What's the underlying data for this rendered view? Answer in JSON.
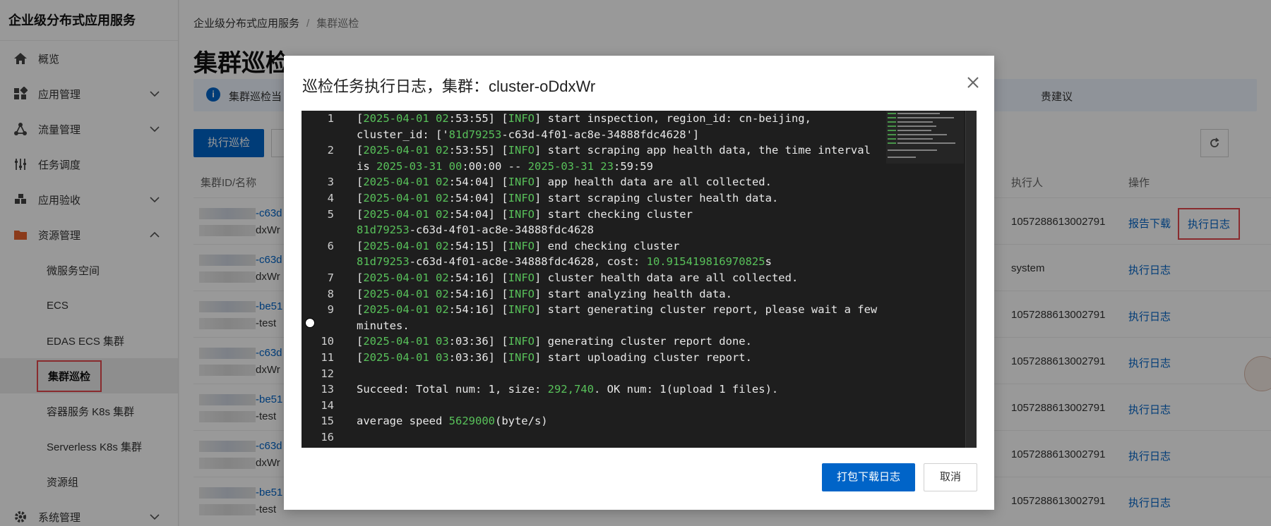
{
  "sidebar": {
    "product_title": "企业级分布式应用服务",
    "items": [
      {
        "label": "概览",
        "icon": "home-icon"
      },
      {
        "label": "应用管理",
        "icon": "apps-icon"
      },
      {
        "label": "流量管理",
        "icon": "traffic-icon"
      },
      {
        "label": "任务调度",
        "icon": "schedule-icon"
      },
      {
        "label": "应用验收",
        "icon": "acceptance-icon"
      },
      {
        "label": "资源管理",
        "icon": "folder-icon"
      }
    ],
    "sub_items": [
      "微服务空间",
      "ECS",
      "EDAS ECS 集群",
      "集群巡检",
      "容器服务 K8s 集群",
      "Serverless K8s 集群",
      "资源组"
    ],
    "bottom_item": {
      "label": "系统管理",
      "icon": "settings-icon"
    }
  },
  "breadcrumb": {
    "root": "企业级分布式应用服务",
    "separator": "/",
    "current": "集群巡检"
  },
  "page": {
    "title": "集群巡检",
    "info_text": "集群巡检当",
    "info_tail": "贵建议",
    "execute_button": "执行巡检"
  },
  "table": {
    "headers": {
      "id": "集群ID/名称",
      "executor": "执行人",
      "actions": "操作"
    },
    "rows": [
      {
        "id": "-c63d",
        "name": "dxWr",
        "executor": "1057288613002791",
        "actions": [
          "报告下载",
          "执行日志"
        ]
      },
      {
        "id": "-c63d",
        "name": "dxWr",
        "executor": "system",
        "actions": [
          "执行日志"
        ]
      },
      {
        "id": "-be51",
        "name": "-test",
        "executor": "1057288613002791",
        "actions": [
          "执行日志"
        ]
      },
      {
        "id": "-c63d",
        "name": "dxWr",
        "executor": "1057288613002791",
        "actions": [
          "执行日志"
        ]
      },
      {
        "id": "-be51",
        "name": "-test",
        "executor": "1057288613002791",
        "actions": [
          "执行日志"
        ]
      },
      {
        "id": "-c63d",
        "name": "dxWr",
        "executor": "1057288613002791",
        "actions": [
          "执行日志"
        ]
      },
      {
        "id": "-be51",
        "name": "-test",
        "executor": "1057288613002791",
        "actions": [
          "执行日志"
        ]
      }
    ]
  },
  "dialog": {
    "title": "巡检任务执行日志，集群：cluster-oDdxWr",
    "primary_button": "打包下载日志",
    "cancel_button": "取消",
    "log_lines": [
      {
        "n": "1",
        "t": "[2025-04-01 02:53:55] [INFO] start inspection, region_id: cn-beijing,"
      },
      {
        "n": "",
        "t": "cluster_id: ['81d79253-c63d-4f01-ac8e-34888fdc4628']"
      },
      {
        "n": "2",
        "t": "[2025-04-01 02:53:55] [INFO] start scraping app health data, the time interval"
      },
      {
        "n": "",
        "t": "is 2025-03-31 00:00:00 -- 2025-03-31 23:59:59"
      },
      {
        "n": "3",
        "t": "[2025-04-01 02:54:04] [INFO] app health data are all collected."
      },
      {
        "n": "4",
        "t": "[2025-04-01 02:54:04] [INFO] start scraping cluster health data."
      },
      {
        "n": "5",
        "t": "[2025-04-01 02:54:04] [INFO] start checking cluster"
      },
      {
        "n": "",
        "t": "81d79253-c63d-4f01-ac8e-34888fdc4628"
      },
      {
        "n": "6",
        "t": "[2025-04-01 02:54:15] [INFO] end checking cluster"
      },
      {
        "n": "",
        "t": "81d79253-c63d-4f01-ac8e-34888fdc4628, cost: 10.915419816970825s"
      },
      {
        "n": "7",
        "t": "[2025-04-01 02:54:16] [INFO] cluster health data are all collected."
      },
      {
        "n": "8",
        "t": "[2025-04-01 02:54:16] [INFO] start analyzing health data."
      },
      {
        "n": "9",
        "t": "[2025-04-01 02:54:16] [INFO] start generating cluster report, please wait a few"
      },
      {
        "n": "",
        "t": "minutes."
      },
      {
        "n": "10",
        "t": "[2025-04-01 03:03:36] [INFO] generating cluster report done."
      },
      {
        "n": "11",
        "t": "[2025-04-01 03:03:36] [INFO] start uploading cluster report."
      },
      {
        "n": "12",
        "t": ""
      },
      {
        "n": "13",
        "t": "Succeed: Total num: 1, size: 292,740. OK num: 1(upload 1 files)."
      },
      {
        "n": "14",
        "t": ""
      },
      {
        "n": "15",
        "t": "average speed 5629000(byte/s)"
      },
      {
        "n": "16",
        "t": ""
      }
    ]
  },
  "colors": {
    "primary": "#0064c8",
    "log_green": "#58c15a",
    "highlight": "#e5484d",
    "log_bg": "#1e1e1e"
  }
}
